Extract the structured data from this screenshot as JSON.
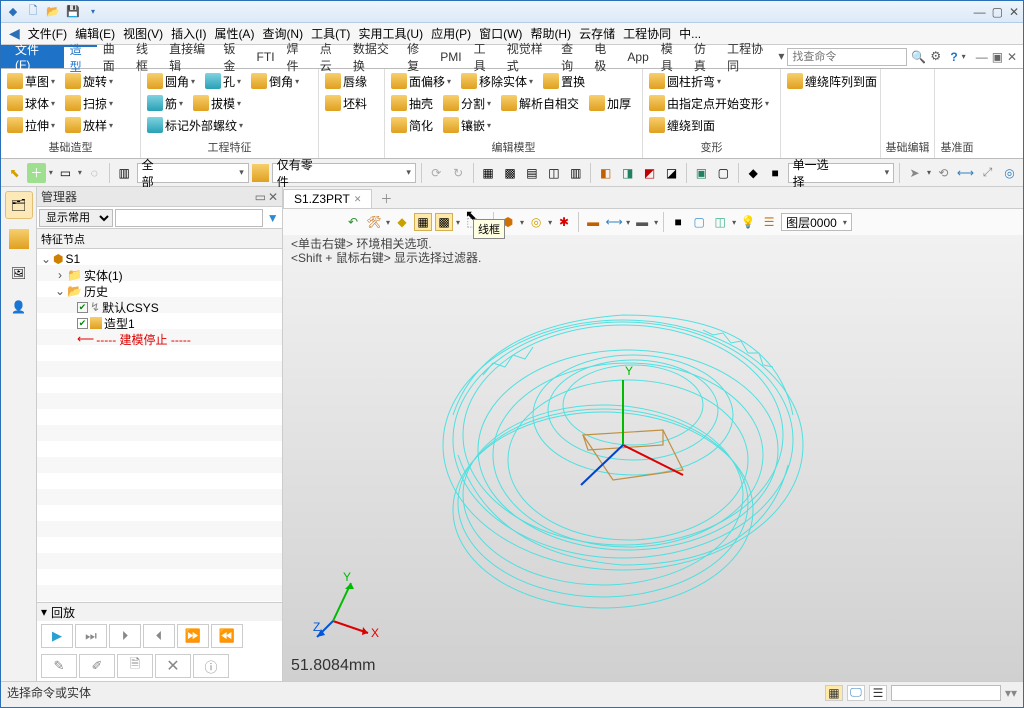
{
  "menus": [
    "文件(F)",
    "编辑(E)",
    "视图(V)",
    "插入(I)",
    "属性(A)",
    "查询(N)",
    "工具(T)",
    "实用工具(U)",
    "应用(P)",
    "窗口(W)",
    "帮助(H)",
    "云存储",
    "工程协同",
    "中..."
  ],
  "file_tab": "文件(F)",
  "tabs": [
    "造型",
    "曲面",
    "线框",
    "直接编辑",
    "钣金",
    "FTI",
    "焊件",
    "点云",
    "数据交换",
    "修复",
    "PMI",
    "工具",
    "视觉样式",
    "查询",
    "电极",
    "App",
    "模具",
    "仿真",
    "工程协同"
  ],
  "search_placeholder": "找查命令",
  "ribbon": {
    "g1": {
      "label": "基础造型",
      "items": [
        "草图",
        "旋转",
        "球体",
        "扫掠",
        "拉伸",
        "放样"
      ]
    },
    "g2": {
      "label": "工程特征",
      "items": [
        "圆角",
        "孔",
        "倒角",
        "筋",
        "拔模",
        "标记外部螺纹"
      ]
    },
    "g3": {
      "label": "",
      "items": [
        "唇缘",
        "坯料"
      ]
    },
    "g4": {
      "label": "编辑模型",
      "items": [
        "面偏移",
        "移除实体",
        "置换",
        "抽壳",
        "分割",
        "解析自相交",
        "加厚",
        "简化",
        "镶嵌"
      ]
    },
    "g5": {
      "label": "变形",
      "items": [
        "圆柱折弯",
        "由指定点开始变形",
        "缠绕到面",
        "缠绕阵列到面"
      ]
    },
    "g6": {
      "label": "基础编辑",
      "items": []
    },
    "g7": {
      "label": "基准面",
      "items": []
    }
  },
  "combo_all": "全部",
  "combo_parts": "仅有零件",
  "combo_single": "单一选择",
  "manager": {
    "title": "管理器",
    "filter": "显示常用",
    "section": "特征节点",
    "playback": "回放",
    "tree": {
      "root": "S1",
      "body": "实体(1)",
      "history": "历史",
      "csys": "默认CSYS",
      "feat": "造型1",
      "stop": "----- 建模停止 -----"
    }
  },
  "tab_name": "S1.Z3PRT",
  "hint1": "<单击右键> 环境相关选项.",
  "hint2": "<Shift + 鼠标右键> 显示选择过滤器.",
  "tooltip": "线框",
  "layer": "图层0000",
  "measurement": "51.8084mm",
  "status": "选择命令或实体",
  "axes": {
    "x": "X",
    "y": "Y",
    "z": "Z"
  }
}
